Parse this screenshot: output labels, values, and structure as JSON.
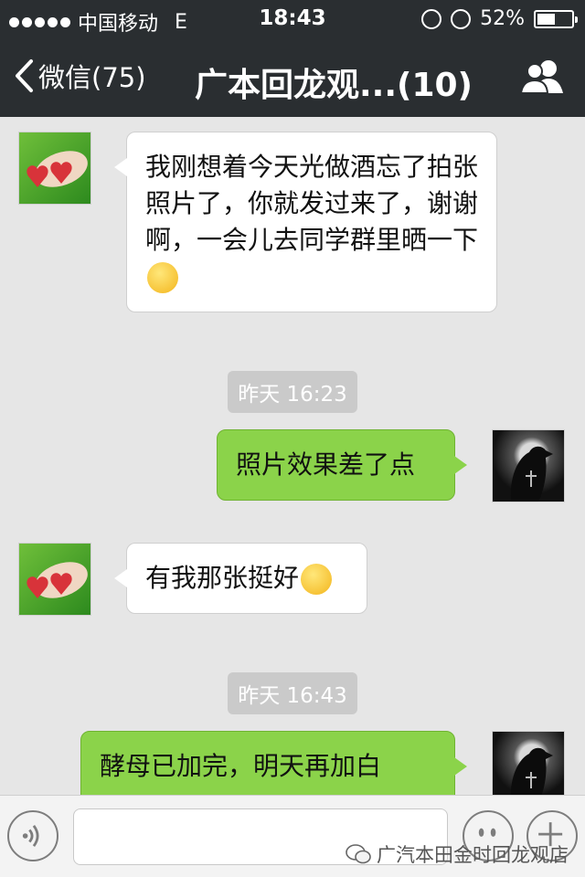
{
  "status_bar": {
    "carrier": "中国移动",
    "network": "E",
    "time": "18:43",
    "battery": "52%",
    "battery_level": 0.52
  },
  "nav": {
    "back_label": "微信(75)",
    "title": "广本回龙观...(10)"
  },
  "messages": [
    {
      "side": "in",
      "text": "我刚想着今天光做酒忘了拍张照片了，你就发过来了，谢谢啊，一会儿去同学群里晒一下",
      "emoji": "smirk-emoji"
    },
    {
      "type": "timestamp",
      "text": "昨天 16:23"
    },
    {
      "side": "out",
      "text": "照片效果差了点"
    },
    {
      "side": "in",
      "text": "有我那张挺好",
      "emoji": "grin-emoji"
    },
    {
      "type": "timestamp",
      "text": "昨天 16:43"
    },
    {
      "side": "out",
      "text": "酵母已加完，明天再加白"
    }
  ],
  "watermark": "广汽本田金时回龙观店",
  "colors": {
    "header": "#2a2e31",
    "background": "#e6e6e6",
    "outgoing_bubble": "#8bd34a",
    "incoming_bubble": "#ffffff"
  }
}
